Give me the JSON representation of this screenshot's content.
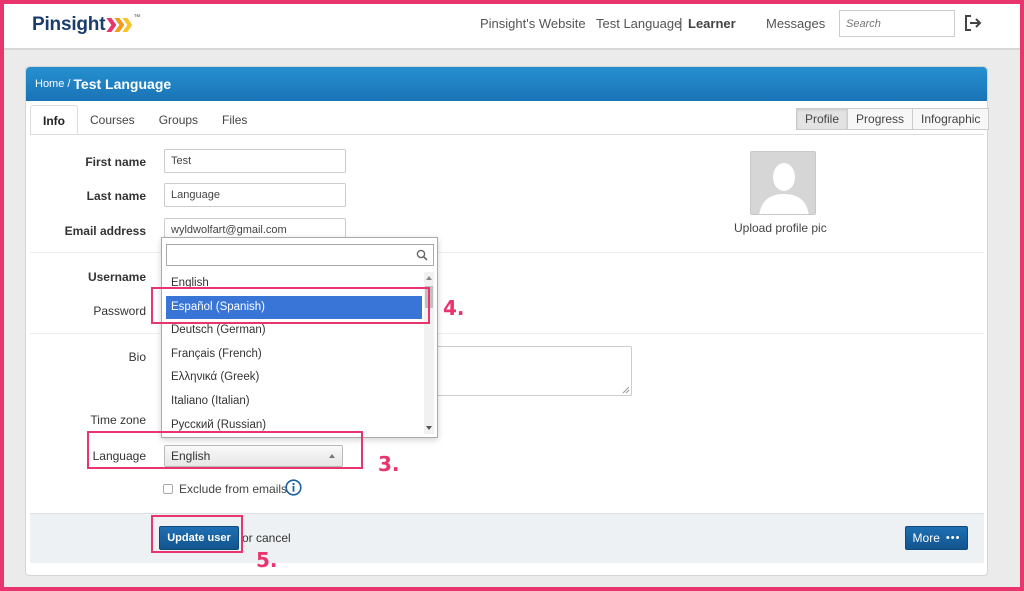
{
  "brand": {
    "name": "Pinsight",
    "trademark": "™",
    "chevron_colors": [
      "#e8356d",
      "#f39a1f",
      "#f7c52a"
    ]
  },
  "nav": {
    "website": "Pinsight's Website",
    "user_name": "Test Language",
    "separator": "|",
    "role": "Learner",
    "messages": "Messages",
    "search_placeholder": "Search"
  },
  "breadcrumb": {
    "home": "Home",
    "separator": "/",
    "current": "Test Language"
  },
  "tabs": [
    "Info",
    "Courses",
    "Groups",
    "Files"
  ],
  "view_buttons": [
    "Profile",
    "Progress",
    "Infographic"
  ],
  "form": {
    "first_name": {
      "label": "First name",
      "value": "Test"
    },
    "last_name": {
      "label": "Last name",
      "value": "Language"
    },
    "email": {
      "label": "Email address",
      "value": "wyldwolfart@gmail.com"
    },
    "username": {
      "label": "Username"
    },
    "password": {
      "label": "Password"
    },
    "bio": {
      "label": "Bio"
    },
    "timezone": {
      "label": "Time zone"
    },
    "language": {
      "label": "Language",
      "value": "English"
    },
    "exclude_emails": {
      "label": "Exclude from emails"
    }
  },
  "profile_pic": {
    "label": "Upload profile pic"
  },
  "dropdown": {
    "options": [
      "English",
      "Español (Spanish)",
      "Deutsch (German)",
      "Français (French)",
      "Ελληνικά (Greek)",
      "Italiano (Italian)",
      "Русский (Russian)"
    ],
    "highlighted_index": 1
  },
  "actions": {
    "update": "Update user",
    "or_cancel": "or cancel",
    "more": "More",
    "more_dots": "•••"
  },
  "annotations": {
    "step3": "3.",
    "step4": "4.",
    "step5": "5.",
    "color": "#e8356d"
  }
}
